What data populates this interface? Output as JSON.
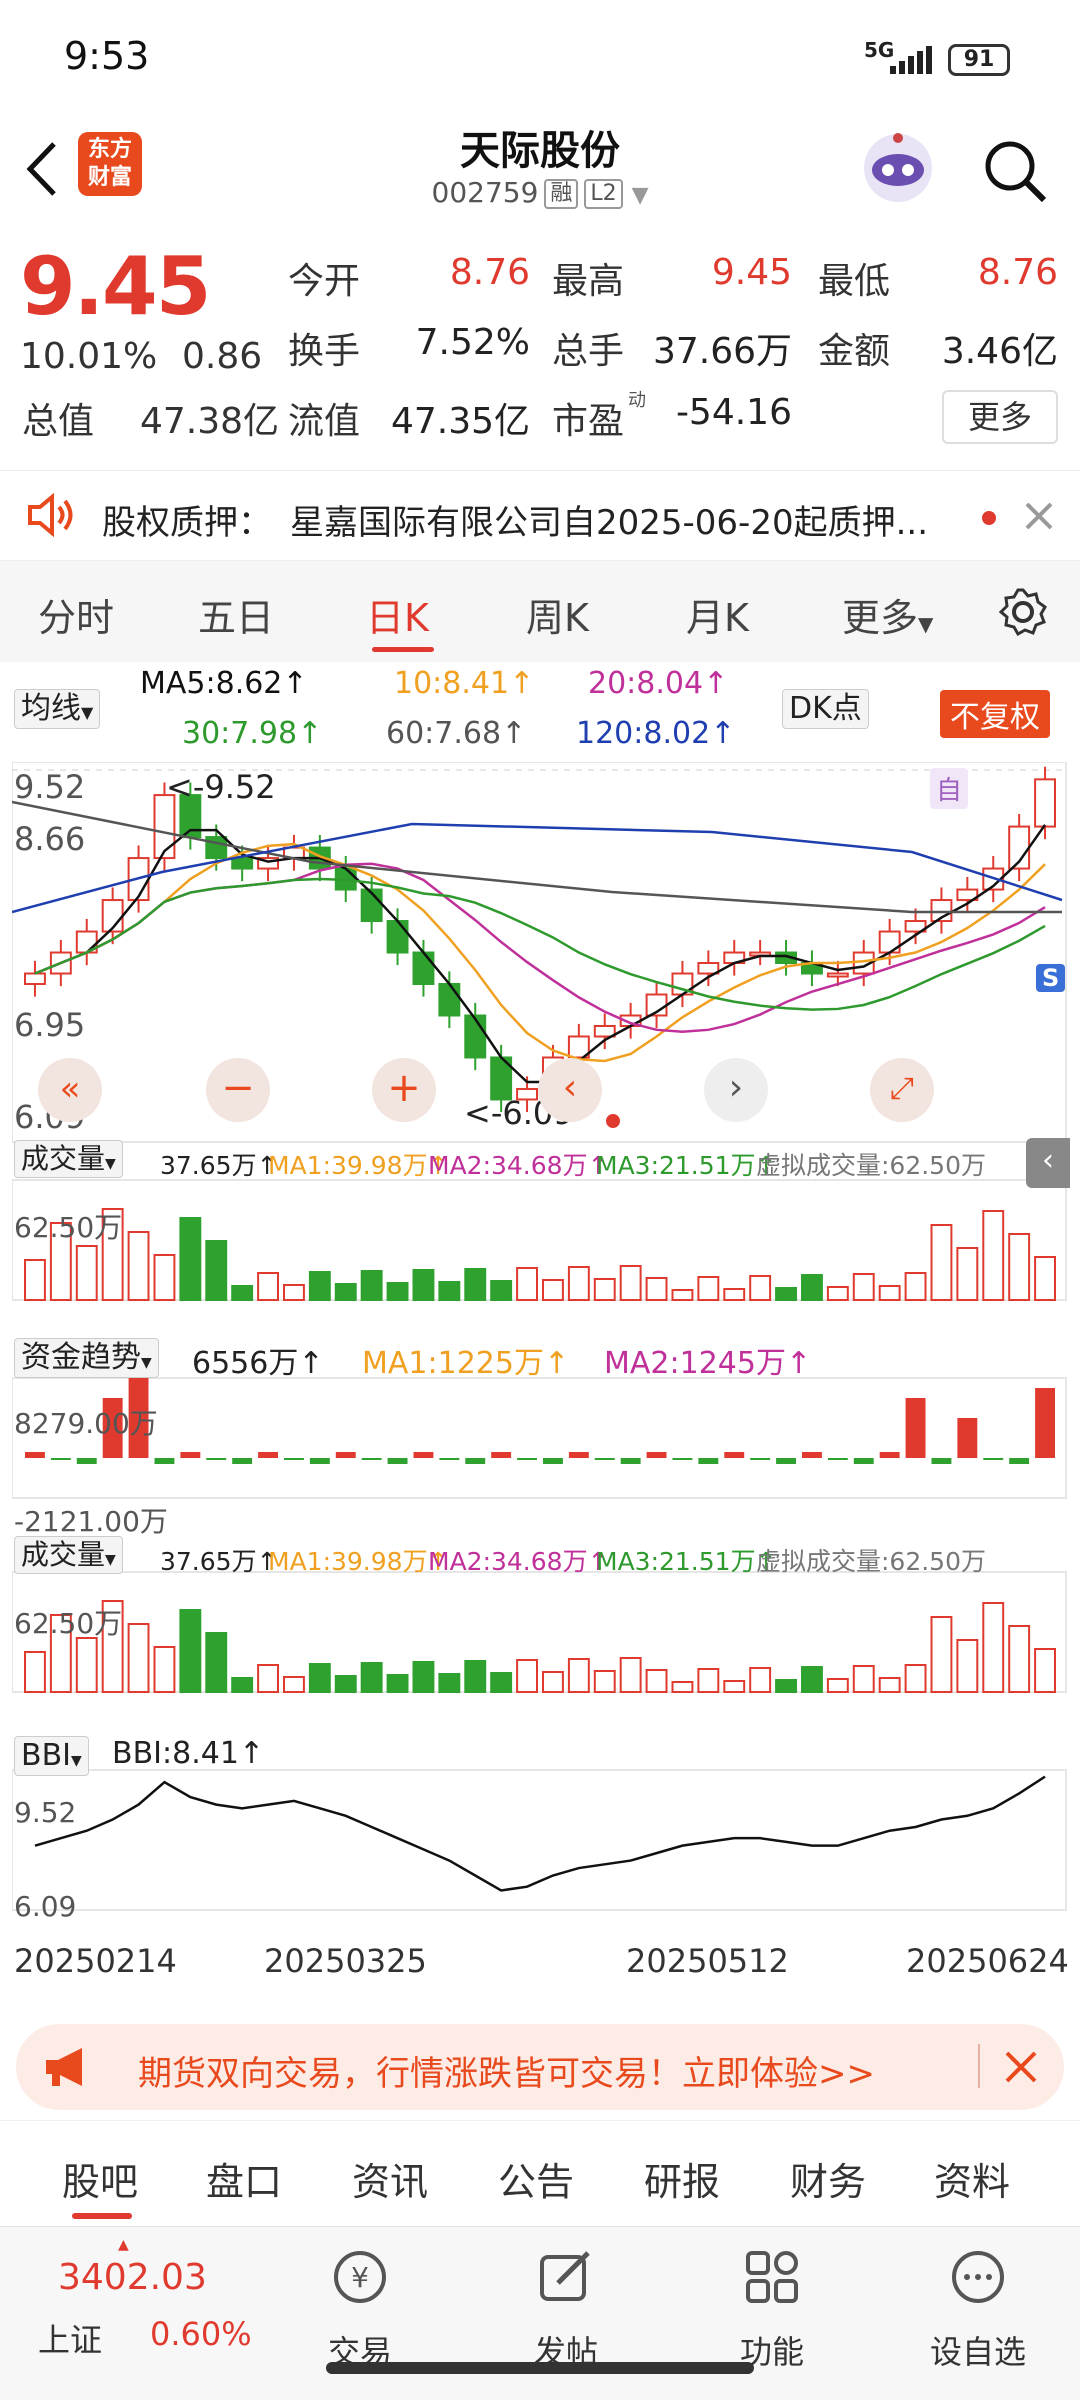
{
  "status_bar": {
    "time": "9:53",
    "network": "5G",
    "battery": "91"
  },
  "header": {
    "title": "天际股份",
    "code": "002759",
    "tag1": "融",
    "tag2": "L2",
    "logo_line1": "东方",
    "logo_line2": "财富"
  },
  "quote": {
    "price": "9.45",
    "change_pct": "10.01%",
    "change": "0.86",
    "open_label": "今开",
    "open": "8.76",
    "high_label": "最高",
    "high": "9.45",
    "low_label": "最低",
    "low": "8.76",
    "turnover_label": "换手",
    "turnover": "7.52%",
    "volume_label": "总手",
    "volume": "37.66万",
    "amount_label": "金额",
    "amount": "3.46亿",
    "mcap_label": "总值",
    "mcap": "47.38亿",
    "float_label": "流值",
    "float": "47.35亿",
    "pe_label": "市盈",
    "pe_sup": "动",
    "pe": "-54.16",
    "more_button": "更多"
  },
  "notice": {
    "label": "股权质押：",
    "text": "星嘉国际有限公司自2025-06-20起质押..."
  },
  "period_tabs": [
    "分时",
    "五日",
    "日K",
    "周K",
    "月K",
    "更多"
  ],
  "active_tab": "日K",
  "chart": {
    "ma_selector": "均线",
    "ma5": "MA5:8.62↑",
    "ma10": "10:8.41↑",
    "ma20": "20:8.04↑",
    "ma30": "30:7.98↑",
    "ma60": "60:7.68↑",
    "ma120": "120:8.02↑",
    "dk_button": "DK点",
    "adjust_button": "不复权",
    "price_high": "9.52",
    "price_mid": "8.66",
    "price_low_mid": "6.95",
    "price_low": "6.09",
    "high_marker": "<-9.52",
    "low_marker": "<-6.09",
    "self_marker": "自",
    "s_marker": "S",
    "volume_selector": "成交量",
    "vol_value": "37.65万↑",
    "vol_ma1": "MA1:39.98万↑",
    "vol_ma2": "MA2:34.68万↑",
    "vol_ma3": "MA3:21.51万↑",
    "virtual_volume": "虚拟成交量:62.50万",
    "vol_axis": "62.50万",
    "fund_selector": "资金趋势",
    "fund_value": "6556万↑",
    "fund_ma1": "MA1:1225万↑",
    "fund_ma2": "MA2:1245万↑",
    "fund_axis_top": "8279.00万",
    "fund_axis_bottom": "-2121.00万",
    "bbi_selector": "BBI",
    "bbi_value": "BBI:8.41↑",
    "bbi_high": "9.52",
    "bbi_low": "6.09",
    "dates": [
      "20250214",
      "20250325",
      "20250512",
      "20250624"
    ],
    "colors": {
      "up": "#e03a2f",
      "down": "#2ea12e",
      "ma5": "#111111",
      "ma10": "#f0a020",
      "ma20": "#c0309a",
      "ma30": "#2e9a2e",
      "ma60": "#555555",
      "ma120": "#1f3fb0"
    }
  },
  "chart_data": {
    "type": "line",
    "title": "天际股份 日K",
    "x_range": [
      "20250214",
      "20250624"
    ],
    "ylim": [
      6.09,
      9.52
    ],
    "series": [
      {
        "name": "MA5",
        "last": 8.62
      },
      {
        "name": "10",
        "last": 8.41
      },
      {
        "name": "20",
        "last": 8.04
      },
      {
        "name": "30",
        "last": 7.98
      },
      {
        "name": "60",
        "last": 7.68
      },
      {
        "name": "120",
        "last": 8.02
      }
    ],
    "close_approx": [
      7.6,
      7.8,
      8.0,
      8.3,
      8.7,
      9.3,
      8.9,
      8.7,
      8.6,
      8.7,
      8.8,
      8.6,
      8.4,
      8.1,
      7.8,
      7.5,
      7.2,
      6.8,
      6.4,
      6.5,
      6.8,
      7.0,
      7.1,
      7.2,
      7.4,
      7.6,
      7.7,
      7.8,
      7.8,
      7.7,
      7.6,
      7.6,
      7.8,
      8.0,
      8.1,
      8.3,
      8.4,
      8.6,
      9.0,
      9.45
    ]
  },
  "ad": {
    "text": "期货双向交易，行情涨跌皆可交易！立即体验>>"
  },
  "sub_tabs": [
    "股吧",
    "盘口",
    "资讯",
    "公告",
    "研报",
    "财务",
    "资料"
  ],
  "active_sub_tab": "股吧",
  "bottom_bar": {
    "index_value": "3402.03",
    "index_name": "上证",
    "index_change": "0.60%",
    "items": [
      "交易",
      "发帖",
      "功能",
      "设自选"
    ]
  }
}
